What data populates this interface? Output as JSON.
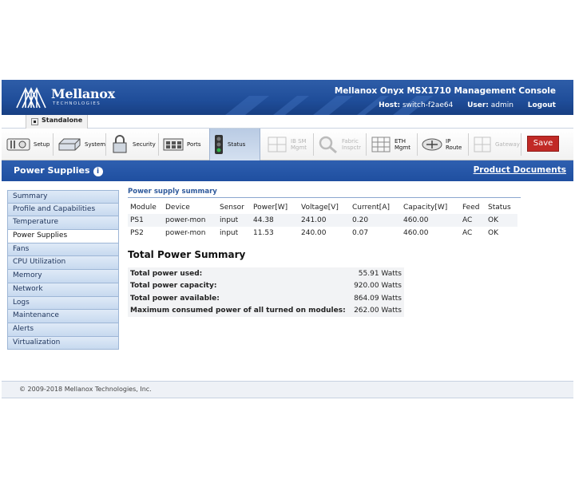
{
  "header": {
    "brand": "Mellanox",
    "brand_sub": "TECHNOLOGIES",
    "console_title": "Mellanox Onyx MSX1710 Management Console",
    "host_label": "Host:",
    "host_value": "switch-f2ae64",
    "user_label": "User:",
    "user_value": "admin",
    "logout_label": "Logout"
  },
  "mode": {
    "label": "Standalone"
  },
  "toolbar": {
    "items": [
      {
        "label": "Setup",
        "icon": "setup-icon",
        "disabled": false
      },
      {
        "label": "System",
        "icon": "system-icon",
        "disabled": false
      },
      {
        "label": "Security",
        "icon": "lock-icon",
        "disabled": false
      },
      {
        "label": "Ports",
        "icon": "ports-icon",
        "disabled": false
      },
      {
        "label": "Status",
        "icon": "traffic-light-icon",
        "disabled": false,
        "active": true
      },
      {
        "label": "IB SM\nMgmt",
        "icon": "ib-sm-icon",
        "disabled": true
      },
      {
        "label": "Fabric\nInspctr",
        "icon": "magnifier-icon",
        "disabled": true
      },
      {
        "label": "ETH\nMgmt",
        "icon": "eth-icon",
        "disabled": false
      },
      {
        "label": "IP\nRoute",
        "icon": "router-icon",
        "disabled": false
      },
      {
        "label": "Gateway",
        "icon": "gateway-icon",
        "disabled": true
      }
    ],
    "save_label": "Save",
    "save_color": "#c12a26"
  },
  "page": {
    "title": "Power Supplies",
    "info_glyph": "i",
    "product_docs": "Product Documents"
  },
  "sidebar": {
    "items": [
      {
        "label": "Summary"
      },
      {
        "label": "Profile and Capabilities"
      },
      {
        "label": "Temperature"
      },
      {
        "label": "Power Supplies",
        "active": true
      },
      {
        "label": "Fans"
      },
      {
        "label": "CPU Utilization"
      },
      {
        "label": "Memory"
      },
      {
        "label": "Network"
      },
      {
        "label": "Logs"
      },
      {
        "label": "Maintenance"
      },
      {
        "label": "Alerts"
      },
      {
        "label": "Virtualization"
      }
    ]
  },
  "summary": {
    "heading": "Power supply summary",
    "columns": [
      "Module",
      "Device",
      "Sensor",
      "Power[W]",
      "Voltage[V]",
      "Current[A]",
      "Capacity[W]",
      "Feed",
      "Status"
    ],
    "rows": [
      [
        "PS1",
        "power-mon",
        "input",
        "44.38",
        "241.00",
        "0.20",
        "460.00",
        "AC",
        "OK"
      ],
      [
        "PS2",
        "power-mon",
        "input",
        "11.53",
        "240.00",
        "0.07",
        "460.00",
        "AC",
        "OK"
      ]
    ]
  },
  "totals": {
    "title": "Total Power Summary",
    "rows": [
      {
        "label": "Total power used:",
        "value": "55.91 Watts"
      },
      {
        "label": "Total power capacity:",
        "value": "920.00 Watts"
      },
      {
        "label": "Total power available:",
        "value": "864.09 Watts"
      },
      {
        "label": "Maximum consumed power of all turned on modules:",
        "value": "262.00 Watts"
      }
    ]
  },
  "footer": {
    "copyright": "© 2009-2018 Mellanox Technologies, Inc."
  },
  "colors": {
    "header_blue": "#1f4d99",
    "accent_blue": "#2f5a9c",
    "save_red": "#c12a26"
  }
}
